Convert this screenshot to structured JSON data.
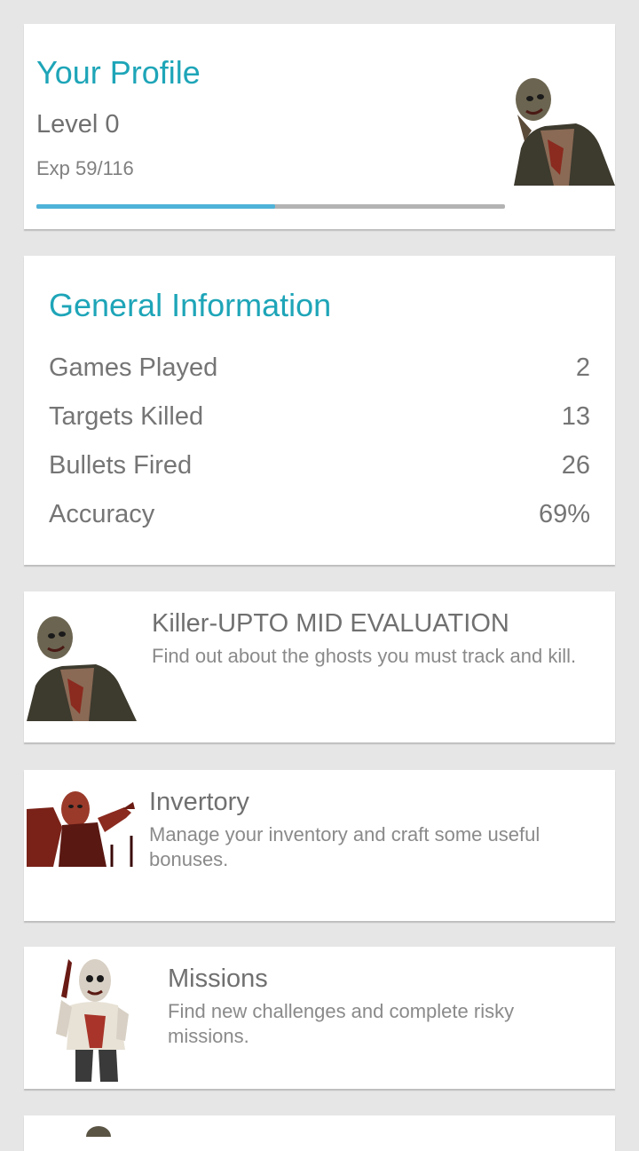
{
  "profile": {
    "title": "Your Profile",
    "level": "Level 0",
    "exp": "Exp 59/116",
    "exp_progress": 0.5086,
    "avatar_icon": "zombie-portrait-icon"
  },
  "general": {
    "title": "General Information",
    "stats": [
      {
        "label": "Games Played",
        "value": "2"
      },
      {
        "label": "Targets Killed",
        "value": "13"
      },
      {
        "label": "Bullets Fired",
        "value": "26"
      },
      {
        "label": "Accuracy",
        "value": "69%"
      }
    ]
  },
  "menu": [
    {
      "title": "Killer-UPTO MID EVALUATION",
      "description": "Find out about the ghosts you must track and kill.",
      "icon": "zombie-icon"
    },
    {
      "title": "Invertory",
      "description": "Manage your inventory and craft some useful bonuses.",
      "icon": "bloody-zombie-icon"
    },
    {
      "title": "Missions",
      "description": "Find new challenges and complete risky missions.",
      "icon": "knife-zombie-icon"
    }
  ],
  "colors": {
    "accent": "#1ea5b8",
    "progress": "#4fb2d8",
    "background": "#e6e6e6"
  }
}
